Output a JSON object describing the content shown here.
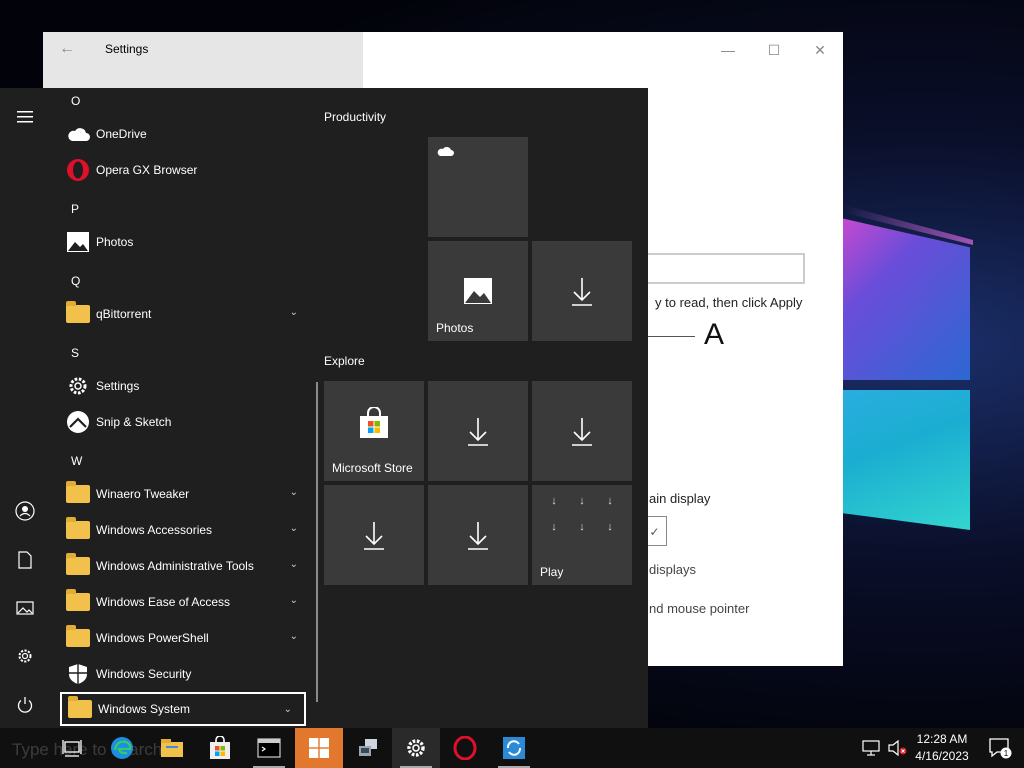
{
  "settings_window": {
    "title": "Settings",
    "back_glyph": "←",
    "minimize_glyph": "—",
    "maximize_glyph": "☐",
    "close_glyph": "✕",
    "text_read": "y to read, then click Apply",
    "sample_letter": "A",
    "text_main_display": "ain display",
    "check_glyph": "✓",
    "text_displays": "displays",
    "text_mouse": "nd mouse pointer"
  },
  "start_menu": {
    "letters": {
      "o": "O",
      "p": "P",
      "q": "Q",
      "s": "S",
      "w": "W"
    },
    "apps": [
      {
        "label": "OneDrive",
        "icon": "onedrive-icon"
      },
      {
        "label": "Opera GX Browser",
        "icon": "opera-icon"
      },
      {
        "label": "Photos",
        "icon": "photos-icon"
      },
      {
        "label": "qBittorrent",
        "icon": "folder-icon",
        "expandable": true
      },
      {
        "label": "Settings",
        "icon": "gear-icon"
      },
      {
        "label": "Snip & Sketch",
        "icon": "snip-icon"
      },
      {
        "label": "Winaero Tweaker",
        "icon": "folder-icon",
        "expandable": true
      },
      {
        "label": "Windows Accessories",
        "icon": "folder-icon",
        "expandable": true
      },
      {
        "label": "Windows Administrative Tools",
        "icon": "folder-icon",
        "expandable": true
      },
      {
        "label": "Windows Ease of Access",
        "icon": "folder-icon",
        "expandable": true
      },
      {
        "label": "Windows PowerShell",
        "icon": "folder-icon",
        "expandable": true
      },
      {
        "label": "Windows Security",
        "icon": "shield-icon"
      },
      {
        "label": "Windows System",
        "icon": "folder-icon",
        "expandable": true,
        "selected": true
      }
    ],
    "groups": {
      "productivity": "Productivity",
      "explore": "Explore"
    },
    "tiles": {
      "photos_label": "Photos",
      "store_label": "Microsoft Store",
      "play_label": "Play"
    }
  },
  "taskbar": {
    "search_ghost": "Type here to search",
    "time": "12:28 AM",
    "date": "4/16/2023",
    "notification_count": "1",
    "accent_color": "#e2782d"
  }
}
